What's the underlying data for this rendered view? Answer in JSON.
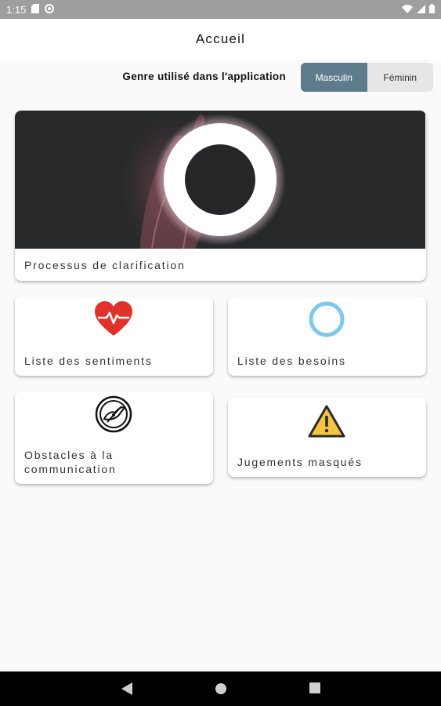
{
  "status_bar": {
    "time": "1:15",
    "left_icons": [
      "sd-card-icon",
      "sync-icon"
    ],
    "right_icons": [
      "wifi-icon",
      "signal-icon",
      "battery-icon"
    ]
  },
  "app_bar": {
    "title": "Accueil"
  },
  "gender": {
    "label": "Genre utilisé dans l'application",
    "options": [
      {
        "label": "Masculin",
        "selected": true
      },
      {
        "label": "Féminin",
        "selected": false
      }
    ]
  },
  "cards": {
    "clarification": {
      "label": "Processus de clarification",
      "icon": "ring-light-image"
    },
    "sentiments": {
      "label": "Liste des sentiments",
      "icon": "heart-pulse-icon"
    },
    "besoins": {
      "label": "Liste des besoins",
      "icon": "circle-icon"
    },
    "obstacles": {
      "label_line1": "Obstacles à la",
      "label_line2": "communication",
      "icon": "obstacle-icon"
    },
    "jugements": {
      "label": "Jugements masqués",
      "icon": "warning-icon"
    }
  },
  "colors": {
    "accent": "#5f7c8c",
    "heart": "#e0322a",
    "circle": "#7ec8ea",
    "warning": "#f5c542"
  },
  "nav_bar": {
    "buttons": [
      "back-icon",
      "home-icon",
      "recents-icon"
    ]
  }
}
